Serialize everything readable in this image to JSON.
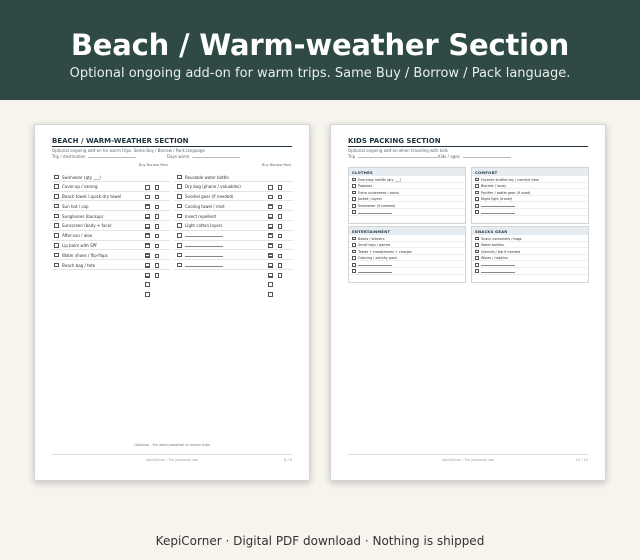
{
  "header": {
    "title": "Beach / Warm-weather Section",
    "subtitle": "Optional ongoing add-on for warm trips. Same Buy / Borrow / Pack language."
  },
  "left_sheet": {
    "title": "BEACH / WARM-WEATHER SECTION",
    "desc": "Optional ongoing add-on for warm trips. Same Buy / Borrow / Pack language",
    "field_trip": "Trip / destination",
    "field_days": "Days warm",
    "col_head": "Buy  Borrow  Pack",
    "left_items": [
      "Swimwear (qty ___)",
      "Cover-up / sarong",
      "Beach towel / quick-dry towel",
      "Sun hat / cap",
      "Sunglasses (backup)",
      "Sunscreen (body + face)",
      "After-sun / aloe",
      "Lip balm with SPF",
      "Water shoes / flip-flops",
      "Beach bag / tote"
    ],
    "right_items": [
      "Reusable water bottle",
      "Dry bag (phone / valuables)",
      "Snorkel gear (if needed)",
      "Cooling towel / mist",
      "Insect repellent",
      "Light cotton layers",
      "",
      "",
      "",
      ""
    ],
    "note": "Optional - For warm-weather or beach trips",
    "footer": "KepiCorner - For personal use",
    "page": "8 / 8"
  },
  "right_sheet": {
    "title": "KIDS PACKING SECTION",
    "desc": "Optional ongoing add-on when traveling with kids",
    "field_trip": "Trip",
    "field_kids": "Kids / ages",
    "boxes": [
      {
        "head": "CLOTHES",
        "items": [
          "Everyday outfits (qty ___)",
          "Pajamas",
          "Extra underwear / socks",
          "Jacket / layers",
          "Swimwear (if needed)",
          ""
        ]
      },
      {
        "head": "COMFORT",
        "items": [
          "Favorite stuffed toy / comfort item",
          "Blanket / lovey",
          "Pacifier / bottle gear (if used)",
          "Night light (travel)",
          "",
          ""
        ]
      },
      {
        "head": "ENTERTAINMENT",
        "items": [
          "Books / stickers",
          "Small toys / games",
          "Tablet + headphones + charger",
          "Coloring / activity pack",
          "",
          ""
        ]
      },
      {
        "head": "SNACKS GEAR",
        "items": [
          "Snack containers / bags",
          "Water bottles",
          "Utensils / bib if needed",
          "Wipes / napkins",
          "",
          ""
        ]
      }
    ],
    "footer": "KepiCorner - For personal use",
    "page": "10 / 10"
  },
  "bottom": {
    "caption": "KepiCorner  ·  Digital PDF download  ·  Nothing is shipped"
  }
}
